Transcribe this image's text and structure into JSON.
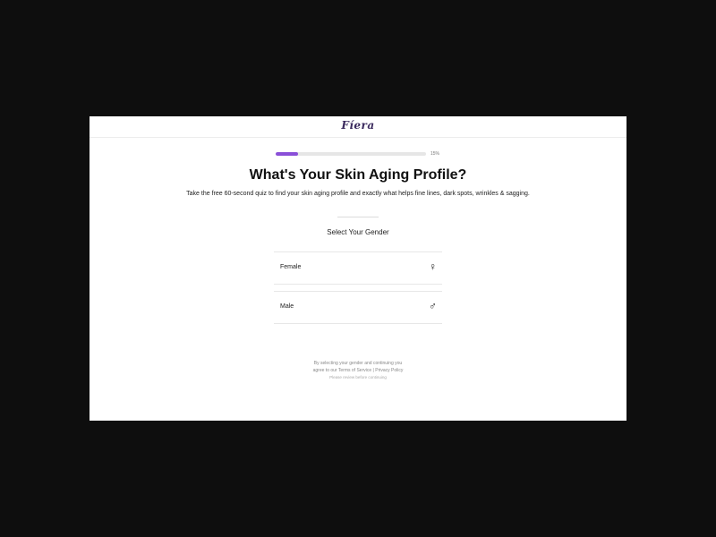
{
  "brand": {
    "logo_text": "Fíera"
  },
  "progress": {
    "value": 0.15,
    "label": "15%"
  },
  "quiz": {
    "title": "What's Your Skin Aging Profile?",
    "subtitle": "Take the free 60-second quiz to find your skin aging profile and exactly what helps fine lines, dark spots, wrinkles & sagging.",
    "question": "Select Your Gender",
    "options": [
      {
        "label": "Female",
        "icon": "female-symbol-icon",
        "glyph": "♀"
      },
      {
        "label": "Male",
        "icon": "male-symbol-icon",
        "glyph": "♂"
      }
    ]
  },
  "legal": {
    "line1": "By selecting your gender and continuing you",
    "agree_prefix": "agree to our",
    "terms": "Terms of Service",
    "separator": "|",
    "privacy": "Privacy Policy",
    "note": "Please review before continuing"
  },
  "colors": {
    "accent": "#8a4fd8",
    "backdrop": "#0e0e0e",
    "logo": "#3b2a5e"
  }
}
